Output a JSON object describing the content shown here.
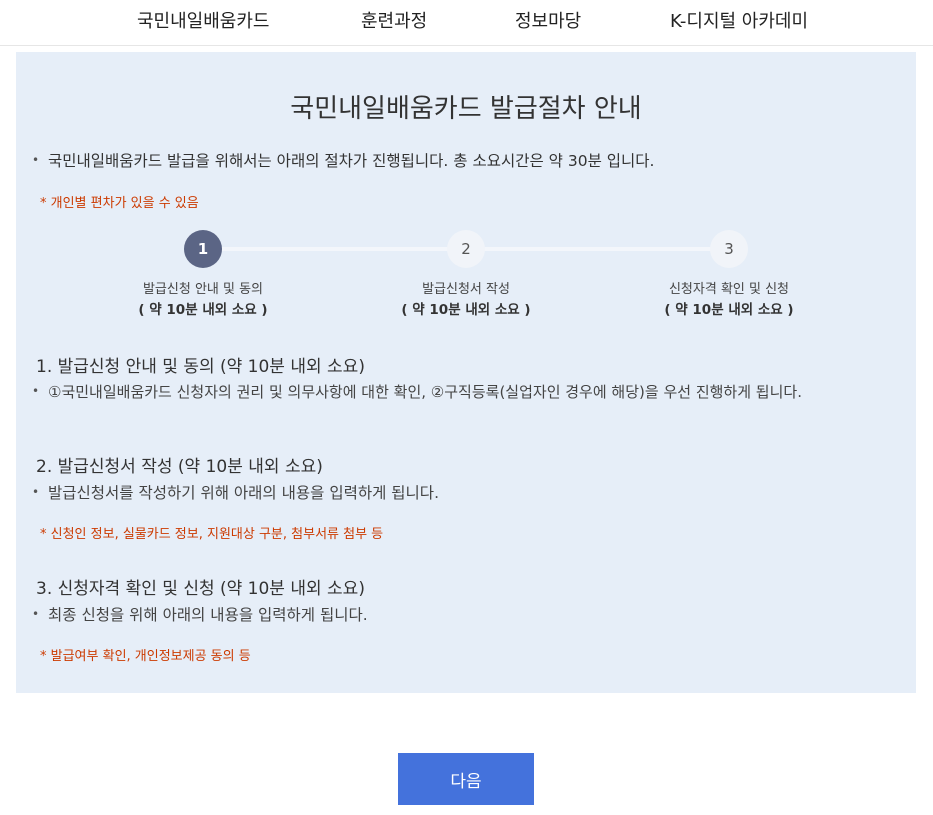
{
  "nav": {
    "items": [
      "국민내일배움카드",
      "훈련과정",
      "정보마당",
      "K-디지털 아카데미"
    ]
  },
  "panel": {
    "title": "국민내일배움카드 발급절차 안내",
    "intro": "국민내일배움카드 발급을 위해서는 아래의 절차가 진행됩니다. 총 소요시간은 약 30분 입니다.",
    "intro_note": "* 개인별 편차가 있을 수 있음",
    "steps": [
      {
        "number": "1",
        "label": "발급신청 안내 및 동의",
        "duration": "( 약 10분 내외 소요 )",
        "active": true
      },
      {
        "number": "2",
        "label": "발급신청서 작성",
        "duration": "( 약 10분 내외 소요 )",
        "active": false
      },
      {
        "number": "3",
        "label": "신청자격 확인 및 신청",
        "duration": "( 약 10분 내외 소요 )",
        "active": false
      }
    ],
    "sections": [
      {
        "title": "1. 발급신청 안내 및 동의 (약 10분 내외 소요)",
        "desc": "①국민내일배움카드 신청자의 권리 및 의무사항에 대한 확인, ②구직등록(실업자인 경우에 해당)을 우선 진행하게 됩니다.",
        "note": ""
      },
      {
        "title": "2. 발급신청서 작성 (약 10분 내외 소요)",
        "desc": "발급신청서를 작성하기 위해 아래의 내용을 입력하게 됩니다.",
        "note": "* 신청인 정보, 실물카드 정보, 지원대상 구분, 첨부서류 첨부 등"
      },
      {
        "title": "3. 신청자격 확인 및 신청 (약 10분 내외 소요)",
        "desc": "최종 신청을 위해 아래의 내용을 입력하게 됩니다.",
        "note": "* 발급여부 확인, 개인정보제공 동의 등"
      }
    ]
  },
  "next_button": {
    "label": "다음"
  },
  "colors": {
    "panel_bg": "#e6eef8",
    "active_step": "#5b6585",
    "note_red": "#cc3a00",
    "button_blue": "#4472dc"
  }
}
